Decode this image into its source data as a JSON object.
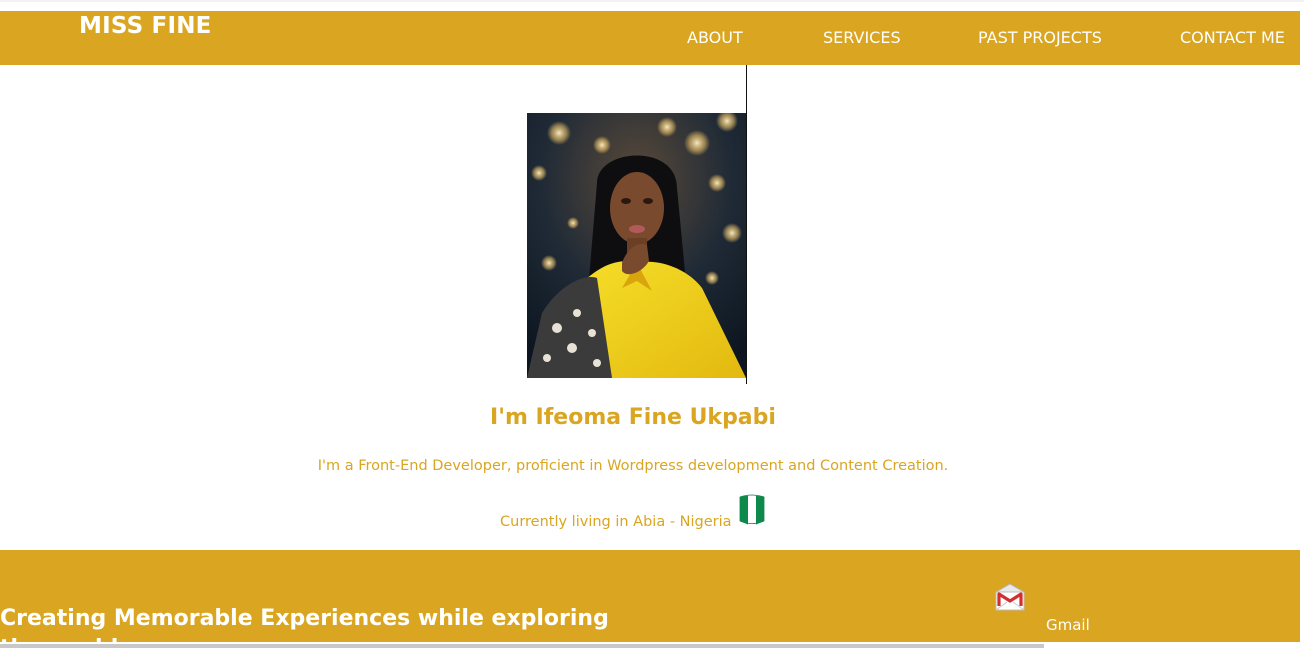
{
  "header": {
    "brand": "MISS FINE",
    "nav": [
      "ABOUT",
      "SERVICES",
      "PAST PROJECTS",
      "CONTACT ME"
    ]
  },
  "hero": {
    "name": "I'm Ifeoma Fine Ukpabi",
    "tagline": "I'm a Front-End Developer, proficient in Wordpress development and Content Creation.",
    "location": "Currently living in Abia - Nigeria",
    "portrait_icon": "portrait-photo",
    "flag_icon": "nigeria-flag-icon"
  },
  "footer": {
    "headline": "Creating Memorable Experiences while exploring the world",
    "contact_label": "Gmail",
    "contact_icon": "gmail-icon"
  },
  "colors": {
    "accent": "#daa520",
    "text_on_accent": "#ffffff"
  }
}
